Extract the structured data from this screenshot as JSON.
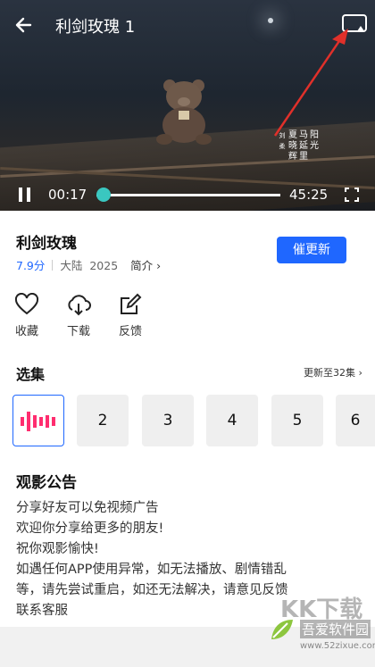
{
  "player": {
    "title": "利剑玫瑰 1",
    "poem_cols": [
      "阳光",
      "马延里",
      "夏晓辉",
      "刘柔"
    ],
    "current_time": "00:17",
    "total_time": "45:25",
    "progress": 0.006
  },
  "show": {
    "title": "利剑玫瑰",
    "score": "7.9分",
    "region": "大陆",
    "year": "2025",
    "intro_label": "简介",
    "urge_button": "催更新"
  },
  "actions": [
    {
      "label": "收藏",
      "icon": "heart-icon"
    },
    {
      "label": "下载",
      "icon": "cloud-download-icon"
    },
    {
      "label": "反馈",
      "icon": "edit-feedback-icon"
    }
  ],
  "episodes": {
    "section_title": "选集",
    "update_text": "更新至32集",
    "items": [
      "",
      "2",
      "3",
      "4",
      "5",
      "6"
    ]
  },
  "notice": {
    "title": "观影公告",
    "lines": [
      "分享好友可以免视频广告",
      "欢迎你分享给更多的朋友!",
      "祝你观影愉快!",
      "如遇任何APP使用异常，如无法播放、剧情错乱",
      "等，请先尝试重启，如还无法解决，请意见反馈",
      "联系客服"
    ]
  },
  "watermark": {
    "big": "KK下载",
    "name": "吾爱软件园",
    "url": "www.52zixue.com"
  },
  "colors": {
    "accent": "#1f67ff",
    "playing": "#ff2d6f",
    "knob": "#3ac7c0"
  }
}
